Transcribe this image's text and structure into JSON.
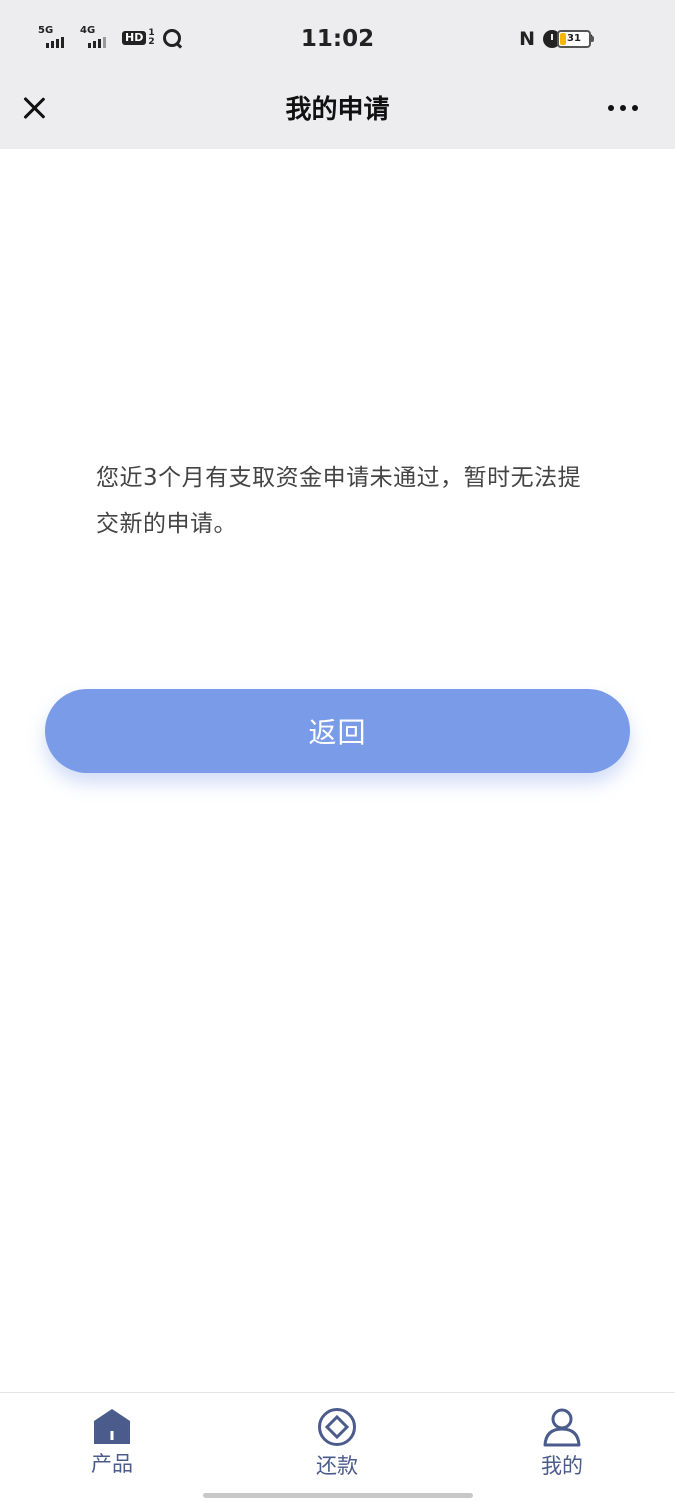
{
  "status_bar": {
    "signal1_label": "5G",
    "signal2_label": "4G",
    "hd_label": "HD",
    "hd_sup_top": "1",
    "hd_sup_bottom": "2",
    "time": "11:02",
    "nfc_label": "N",
    "battery_level": "31",
    "icons": [
      "signal-5g-icon",
      "signal-4g-icon",
      "hd-icon",
      "q-icon",
      "nfc-icon",
      "alarm-icon",
      "wifi-icon",
      "battery-icon"
    ]
  },
  "header": {
    "title": "我的申请",
    "close_icon": "close-icon",
    "more_icon": "more-icon"
  },
  "main": {
    "message": "您近3个月有支取资金申请未通过，暂时无法提交新的申请。",
    "back_button_label": "返回"
  },
  "tabbar": {
    "tabs": [
      {
        "label": "产品",
        "icon": "home-icon"
      },
      {
        "label": "还款",
        "icon": "repay-icon"
      },
      {
        "label": "我的",
        "icon": "user-icon"
      }
    ]
  },
  "colors": {
    "accent": "#7a9be8",
    "tab_icon": "#4b5c8c",
    "header_bg": "#edecee"
  }
}
